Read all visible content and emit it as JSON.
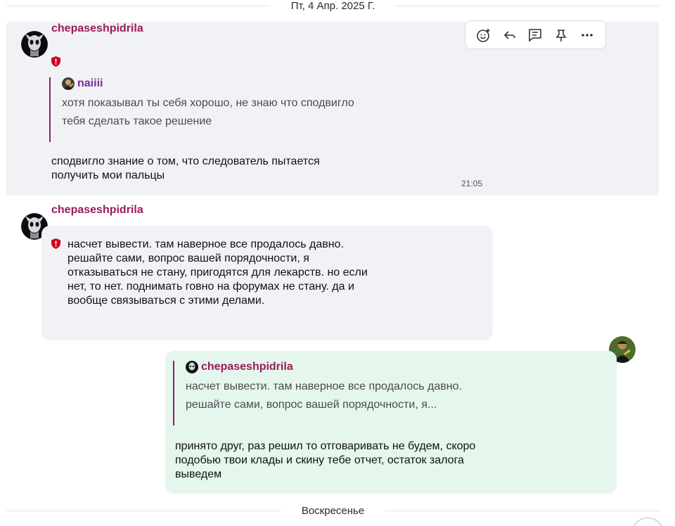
{
  "date_separators": {
    "top": "Пт, 4 Апр. 2025 Г.",
    "bottom": "Воскресенье"
  },
  "toolbar": {
    "icons": [
      "emoji-add-icon",
      "reply-icon",
      "thread-icon",
      "pin-icon",
      "more-icon"
    ]
  },
  "messages": [
    {
      "author": "chepaseshpidrila",
      "quote": {
        "author": "naiiii",
        "text_line1": "хотя показывал ты себя хорошо, не знаю что сподвигло",
        "text_line2": "тебя сделать такое решение"
      },
      "text_line1": "сподвигло знание о том, что следователь пытается",
      "text_line2": "получить мои пальцы",
      "time": "21:05"
    },
    {
      "author": "chepaseshpidrila",
      "lines": [
        "насчет вывести. там наверное все продалось давно.",
        "решайте сами, вопрос вашей порядочности, я",
        "отказываться не стану, пригодятся для лекарств. но если",
        "нет, то нет. поднимать говно на форумах не стану. да и",
        "вообще связываться с этими делами."
      ]
    },
    {
      "quote": {
        "author": "chepaseshpidrila",
        "text_line1": "насчет вывести. там наверное все продалось давно.",
        "text_line2": "решайте сами, вопрос вашей порядочности, я..."
      },
      "lines": [
        "принято друг, раз решил то отговаривать не будем, скоро",
        "подобью твои клады и скину тебе отчет, остаток залога",
        "выведем"
      ]
    }
  ],
  "colors": {
    "author": "#9c1a5a",
    "quote_bar": "#8b1e6f",
    "quote_author_2": "#7a2a9e",
    "shield": "#d0021b",
    "own_bubble": "#e5f6ec",
    "other_bubble": "#f1f2f5"
  }
}
